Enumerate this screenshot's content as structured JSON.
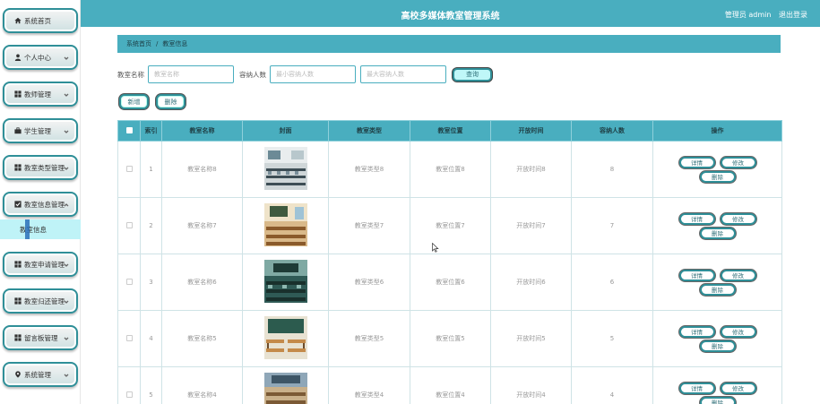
{
  "header": {
    "title": "高校多媒体教室管理系统",
    "user_label": "管理员 admin",
    "logout_label": "退出登录"
  },
  "sidebar": {
    "items": [
      {
        "label": "系统首页",
        "icon": "home-icon"
      },
      {
        "label": "个人中心",
        "icon": "user-icon"
      },
      {
        "label": "教师管理",
        "icon": "grid-icon"
      },
      {
        "label": "学生管理",
        "icon": "briefcase-icon"
      },
      {
        "label": "教室类型管理",
        "icon": "grid-icon"
      },
      {
        "label": "教室信息管理",
        "icon": "checkbox-icon"
      },
      {
        "label": "教室申请管理",
        "icon": "grid-icon"
      },
      {
        "label": "教室归还管理",
        "icon": "grid-icon"
      },
      {
        "label": "留言板管理",
        "icon": "grid-icon"
      },
      {
        "label": "系统管理",
        "icon": "location-icon"
      }
    ],
    "active_sub": "教室信息"
  },
  "breadcrumb": {
    "home": "系统首页",
    "separator": "/",
    "current": "教室信息"
  },
  "search": {
    "name_label": "教室名称",
    "name_placeholder": "教室名称",
    "capacity_label": "容纳人数",
    "min_placeholder": "最小容纳人数",
    "max_placeholder": "最大容纳人数",
    "query_label": "查询"
  },
  "toolbar": {
    "add_label": "新增",
    "delete_label": "删除"
  },
  "table": {
    "columns": [
      "索引",
      "教室名称",
      "封面",
      "教室类型",
      "教室位置",
      "开放时间",
      "容纳人数",
      "操作"
    ],
    "rows": [
      {
        "index": "1",
        "name": "教室名称8",
        "type": "教室类型8",
        "location": "教室位置8",
        "open": "开放时间8",
        "capacity": "8"
      },
      {
        "index": "2",
        "name": "教室名称7",
        "type": "教室类型7",
        "location": "教室位置7",
        "open": "开放时间7",
        "capacity": "7"
      },
      {
        "index": "3",
        "name": "教室名称6",
        "type": "教室类型6",
        "location": "教室位置6",
        "open": "开放时间6",
        "capacity": "6"
      },
      {
        "index": "4",
        "name": "教室名称5",
        "type": "教室类型5",
        "location": "教室位置5",
        "open": "开放时间5",
        "capacity": "5"
      },
      {
        "index": "5",
        "name": "教室名称4",
        "type": "教室类型4",
        "location": "教室位置4",
        "open": "开放时间4",
        "capacity": "4"
      }
    ],
    "actions": {
      "detail": "详情",
      "edit": "修改",
      "delete": "删除"
    }
  },
  "colors": {
    "accent": "#49aebf",
    "button_border": "#2f8f98",
    "active_sub_bg": "#bff3f7"
  }
}
